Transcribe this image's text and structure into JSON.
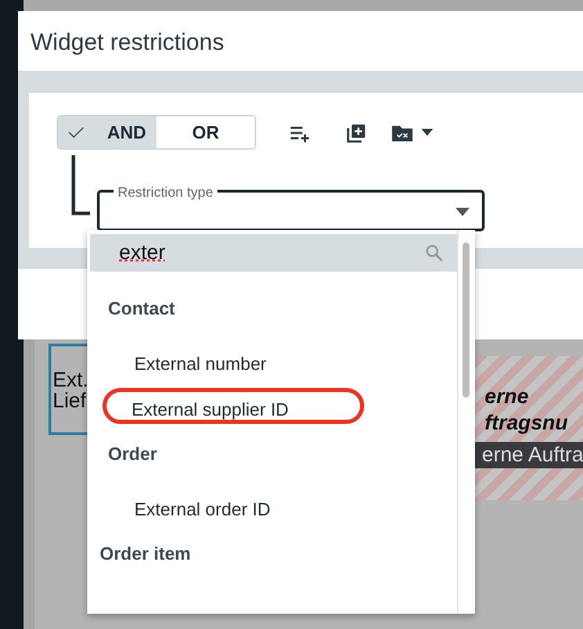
{
  "dialog": {
    "title": "Widget restrictions"
  },
  "logic_toggle": [
    {
      "label": "AND",
      "selected": true
    },
    {
      "label": "OR",
      "selected": false
    }
  ],
  "restriction_field": {
    "label": "Restriction type"
  },
  "dropdown": {
    "search_value": "exter",
    "groups": [
      {
        "label": "Contact",
        "children": [
          {
            "label": "External number",
            "highlighted": false
          },
          {
            "label": "External supplier ID",
            "highlighted": true
          }
        ]
      },
      {
        "label": "Order",
        "children": [
          {
            "label": "External order ID",
            "highlighted": false
          }
        ]
      },
      {
        "label": "Order item"
      }
    ]
  },
  "background": {
    "field_label_lines": [
      "Ext.",
      "Lief"
    ],
    "striped_label_lines": [
      "erne",
      "ftragsnu"
    ],
    "striped_caption": "erne Auftra"
  }
}
